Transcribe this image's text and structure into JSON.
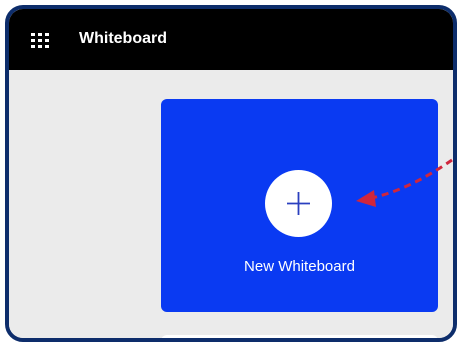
{
  "header": {
    "app_launcher_icon": "waffle-grid-icon",
    "title": "Whiteboard"
  },
  "main": {
    "new_card": {
      "label": "New Whiteboard",
      "icon": "plus-icon",
      "color": "#0a3af2"
    }
  },
  "annotation": {
    "arrow_color": "#d0263c",
    "style": "dashed"
  }
}
